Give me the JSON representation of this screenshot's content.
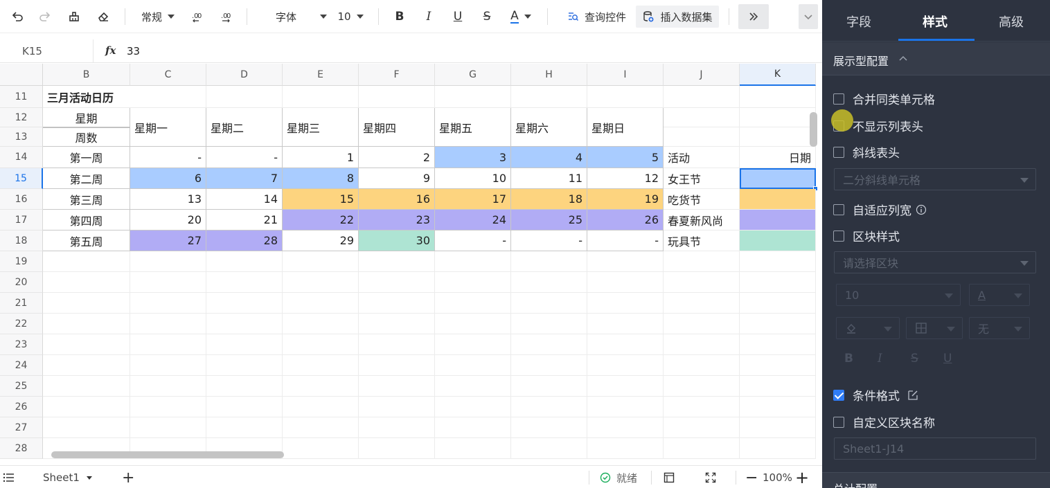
{
  "toolbar": {
    "number_format": "常规",
    "font": "字体",
    "font_size": "10",
    "bold": "B",
    "italic": "I",
    "underline": "U",
    "strike": "S",
    "font_color": "A",
    "query_control": "查询控件",
    "insert_dataset": "插入数据集"
  },
  "formula_bar": {
    "cell_ref": "K15",
    "fx": "fx",
    "value": "33"
  },
  "columns": [
    "B",
    "C",
    "D",
    "E",
    "F",
    "G",
    "H",
    "I",
    "J",
    "K"
  ],
  "rows": [
    "11",
    "12",
    "13",
    "14",
    "15",
    "16",
    "17",
    "18",
    "19",
    "20",
    "21",
    "22",
    "23",
    "24",
    "25",
    "26",
    "27",
    "28"
  ],
  "sheet": {
    "title": "三月活动日历",
    "header_week_label": "星期",
    "header_weeknum_label": "周数",
    "weekdays": [
      "星期一",
      "星期二",
      "星期三",
      "星期四",
      "星期五",
      "星期六",
      "星期日"
    ],
    "weeks": [
      {
        "label": "第一周",
        "days": [
          "-",
          "-",
          "1",
          "2",
          "3",
          "4",
          "5"
        ],
        "event": "活动",
        "date": "日期"
      },
      {
        "label": "第二周",
        "days": [
          "6",
          "7",
          "8",
          "9",
          "10",
          "11",
          "12"
        ],
        "event": "女王节",
        "date": ""
      },
      {
        "label": "第三周",
        "days": [
          "13",
          "14",
          "15",
          "16",
          "17",
          "18",
          "19"
        ],
        "event": "吃货节",
        "date": ""
      },
      {
        "label": "第四周",
        "days": [
          "20",
          "21",
          "22",
          "23",
          "24",
          "25",
          "26"
        ],
        "event": "春夏新风尚",
        "date": ""
      },
      {
        "label": "第五周",
        "days": [
          "27",
          "28",
          "29",
          "30",
          "-",
          "-",
          "-"
        ],
        "event": "玩具节",
        "date": ""
      }
    ],
    "highlight_colors": {
      "blue": "#a9ccff",
      "orange": "#fdd47f",
      "purple": "#b1acf5",
      "teal": "#aee4d3"
    }
  },
  "statusbar": {
    "sheet_name": "Sheet1",
    "ready": "就绪",
    "zoom": "100%"
  },
  "panel": {
    "tabs": [
      "字段",
      "样式",
      "高级"
    ],
    "active_tab": "样式",
    "section_title": "展示型配置",
    "options": {
      "merge_cells": "合并同类单元格",
      "hide_col_header": "不显示列表头",
      "diagonal_header": "斜线表头",
      "diagonal_select": "二分斜线单元格",
      "auto_width": "自适应列宽",
      "block_style": "区块样式",
      "block_select": "请选择区块",
      "font_size": "10",
      "font_glyph": "A",
      "no_border": "无",
      "conditional_format": "条件格式",
      "custom_block_name": "自定义区块名称",
      "block_name_value": "Sheet1-J14",
      "next_section": "总计配置"
    }
  }
}
